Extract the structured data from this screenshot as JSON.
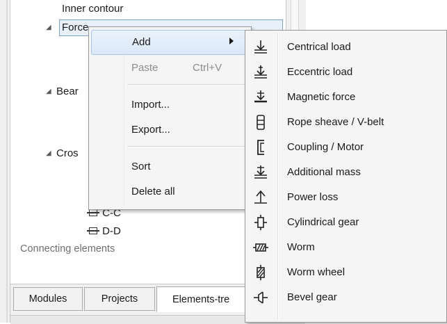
{
  "tree": {
    "nodes": [
      {
        "label": "Inner contour"
      },
      {
        "label": "Force"
      },
      {
        "label": "Bear"
      },
      {
        "label": "Cros"
      },
      {
        "label": "C-C"
      },
      {
        "label": "D-D"
      },
      {
        "label": "Connecting elements"
      }
    ],
    "expander_glyph": "◢"
  },
  "tabs": [
    {
      "label": "Modules"
    },
    {
      "label": "Projects"
    },
    {
      "label": "Elements-tre"
    }
  ],
  "context_menu": {
    "items": [
      {
        "label": "Add",
        "has_submenu": true,
        "state": "hover"
      },
      {
        "label": "Paste",
        "shortcut": "Ctrl+V",
        "state": "disabled"
      },
      {
        "label": "Import..."
      },
      {
        "label": "Export..."
      },
      {
        "label": "Sort"
      },
      {
        "label": "Delete all"
      }
    ]
  },
  "submenu": {
    "items": [
      {
        "label": "Centrical load",
        "icon": "centrical-load-icon"
      },
      {
        "label": "Eccentric load",
        "icon": "eccentric-load-icon"
      },
      {
        "label": "Magnetic force",
        "icon": "magnetic-force-icon"
      },
      {
        "label": "Rope sheave / V-belt",
        "icon": "rope-sheave-icon"
      },
      {
        "label": "Coupling / Motor",
        "icon": "coupling-motor-icon"
      },
      {
        "label": "Additional mass",
        "icon": "additional-mass-icon"
      },
      {
        "label": "Power loss",
        "icon": "power-loss-icon"
      },
      {
        "label": "Cylindrical gear",
        "icon": "cylindrical-gear-icon"
      },
      {
        "label": "Worm",
        "icon": "worm-icon"
      },
      {
        "label": "Worm wheel",
        "icon": "worm-wheel-icon"
      },
      {
        "label": "Bevel gear",
        "icon": "bevel-gear-icon"
      }
    ]
  },
  "colors": {
    "hover_border": "#a9c5ea",
    "selection_border": "#7da2ce",
    "disabled_text": "#8d8d8d"
  }
}
